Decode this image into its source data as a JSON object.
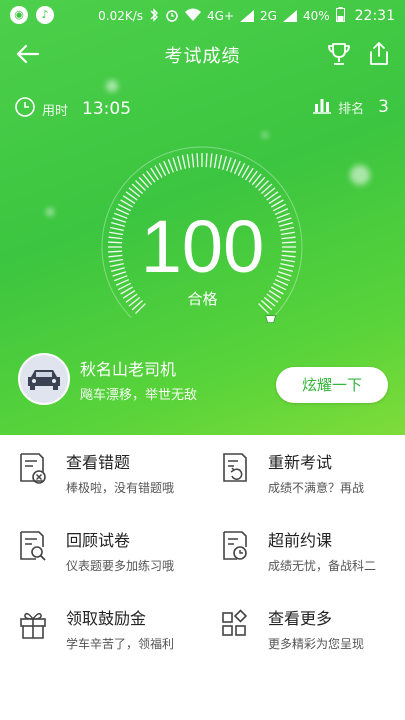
{
  "status_bar": {
    "net_speed": "0.02K/s",
    "network": "4G+",
    "network2": "2G",
    "battery": "40%",
    "time": "22:31",
    "icons": [
      "wechat-icon",
      "volume-icon",
      "bluetooth-icon",
      "alarm-icon",
      "wifi-icon",
      "signal-icon",
      "battery-icon"
    ]
  },
  "header": {
    "title": "考试成绩",
    "back_icon": "arrow-left-icon",
    "trophy_icon": "trophy-icon",
    "share_icon": "share-icon"
  },
  "stats": {
    "time_label": "用时",
    "time_value": "13:05",
    "rank_label": "排名",
    "rank_value": "3"
  },
  "result": {
    "score": "100",
    "status": "合格",
    "gauge_fraction": 1.0
  },
  "user": {
    "name": "秋名山老司机",
    "slogan": "飚车漂移，举世无敌",
    "show_off_button": "炫耀一下"
  },
  "menu": [
    {
      "title": "查看错题",
      "desc": "棒极啦，没有错题哦",
      "icon": "wrong-questions-icon"
    },
    {
      "title": "重新考试",
      "desc": "成绩不满意？再战",
      "icon": "retake-exam-icon"
    },
    {
      "title": "回顾试卷",
      "desc": "仪表题要多加练习哦",
      "icon": "review-paper-icon"
    },
    {
      "title": "超前约课",
      "desc": "成绩无忧，备战科二",
      "icon": "book-lesson-icon"
    },
    {
      "title": "领取鼓励金",
      "desc": "学车辛苦了，领福利",
      "icon": "gift-icon"
    },
    {
      "title": "查看更多",
      "desc": "更多精彩为您呈现",
      "icon": "more-apps-icon"
    }
  ],
  "colors": {
    "primary_green": "#3cc540",
    "button_text": "#35b63a",
    "icon_gray": "#444444"
  }
}
